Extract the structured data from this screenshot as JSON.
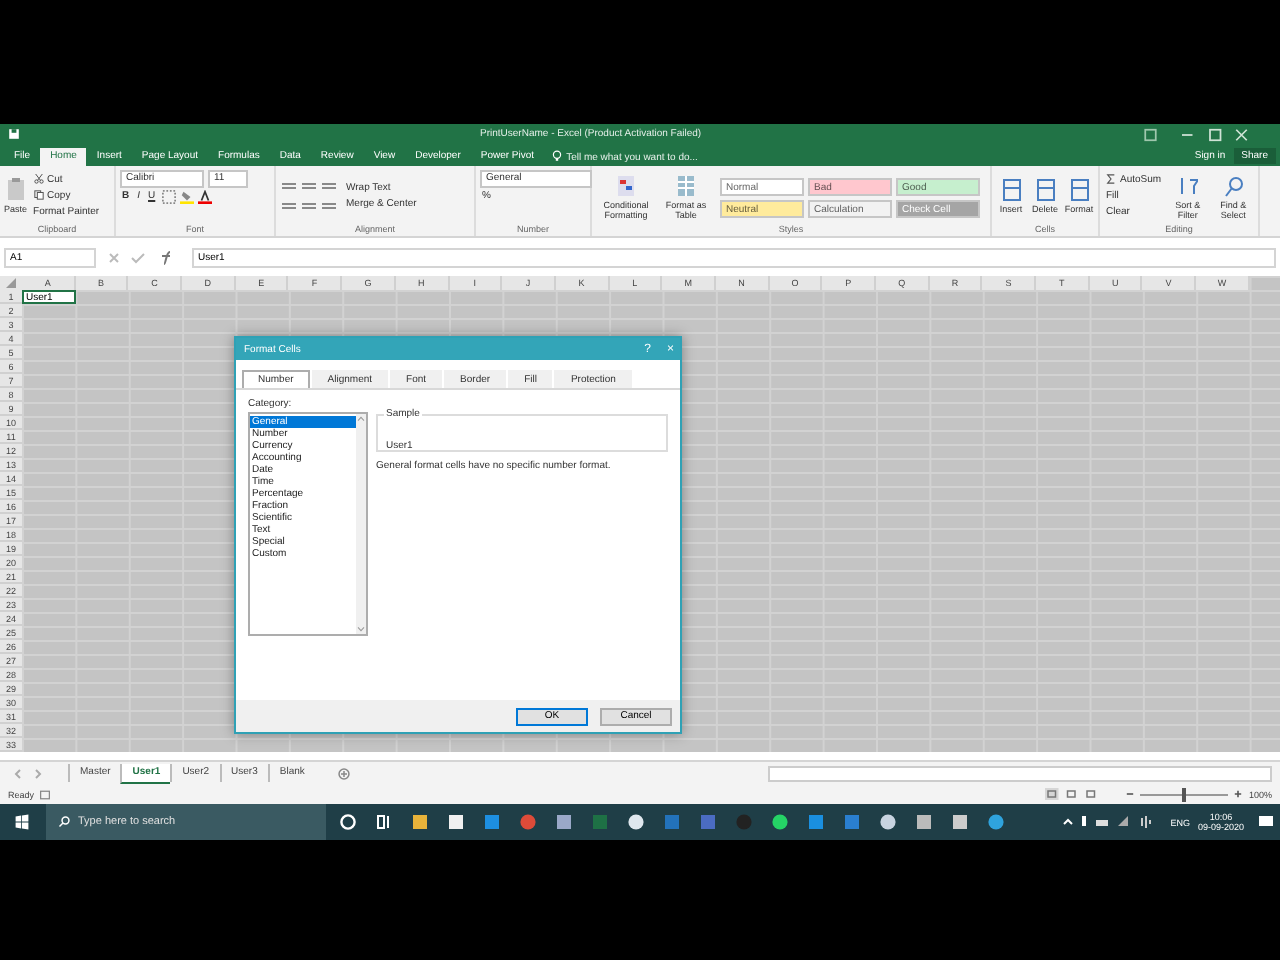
{
  "window": {
    "title": "PrintUserName - Excel (Product Activation Failed)"
  },
  "ribbon_tabs": [
    {
      "label": "File",
      "selected": false
    },
    {
      "label": "Home",
      "selected": true
    },
    {
      "label": "Insert",
      "selected": false
    },
    {
      "label": "Page Layout",
      "selected": false
    },
    {
      "label": "Formulas",
      "selected": false
    },
    {
      "label": "Data",
      "selected": false
    },
    {
      "label": "Review",
      "selected": false
    },
    {
      "label": "View",
      "selected": false
    },
    {
      "label": "Developer",
      "selected": false
    },
    {
      "label": "Power Pivot",
      "selected": false
    }
  ],
  "tell_me": {
    "placeholder": "Tell me what you want to do..."
  },
  "account": {
    "sign_in": "Sign in",
    "share": "Share"
  },
  "ribbon": {
    "clipboard": {
      "label": "Clipboard",
      "paste": "Paste",
      "cut": "Cut",
      "copy": "Copy",
      "format_painter": "Format Painter"
    },
    "font": {
      "label": "Font",
      "name": "Calibri",
      "size": "11",
      "bold": "B",
      "italic": "I",
      "underline": "U"
    },
    "alignment": {
      "label": "Alignment",
      "wrap_text": "Wrap Text",
      "merge": "Merge & Center"
    },
    "number": {
      "label": "Number",
      "format": "General",
      "percent": "%"
    },
    "styles": {
      "label": "Styles",
      "conditional": "Conditional Formatting",
      "table": "Format as Table",
      "cell_styles": [
        {
          "label": "Normal",
          "color": "#ffffff"
        },
        {
          "label": "Bad",
          "color": "#ffc7ce"
        },
        {
          "label": "Good",
          "color": "#c6efce"
        },
        {
          "label": "Neutral",
          "color": "#ffeb9c"
        },
        {
          "label": "Calculation",
          "color": "#f2f2f2"
        },
        {
          "label": "Check Cell",
          "color": "#a5a5a5"
        }
      ]
    },
    "cells": {
      "label": "Cells",
      "buttons": [
        "Insert",
        "Delete",
        "Format"
      ]
    },
    "editing": {
      "label": "Editing",
      "autosum": "AutoSum",
      "fill": "Fill",
      "clear": "Clear",
      "sort": "Sort & Filter",
      "find": "Find & Select"
    }
  },
  "formula_bar": {
    "name_box": "A1",
    "value": "User1"
  },
  "grid": {
    "columns": [
      "A",
      "B",
      "C",
      "D",
      "E",
      "F",
      "G",
      "H",
      "I",
      "J",
      "K",
      "L",
      "M",
      "N",
      "O",
      "P",
      "Q",
      "R",
      "S",
      "T",
      "U",
      "V",
      "W"
    ],
    "rows": [
      "1",
      "2",
      "3",
      "4",
      "5",
      "6",
      "7",
      "8",
      "9",
      "10",
      "11",
      "12",
      "13",
      "14",
      "15",
      "16",
      "17",
      "18",
      "19",
      "20",
      "21",
      "22",
      "23",
      "24",
      "25",
      "26",
      "27",
      "28",
      "29",
      "30",
      "31",
      "32",
      "33"
    ],
    "active_cell": {
      "value": "User1"
    }
  },
  "dialog": {
    "title": "Format Cells",
    "help": "?",
    "close": "×",
    "tabs": [
      {
        "label": "Number",
        "selected": true
      },
      {
        "label": "Alignment",
        "selected": false
      },
      {
        "label": "Font",
        "selected": false
      },
      {
        "label": "Border",
        "selected": false
      },
      {
        "label": "Fill",
        "selected": false
      },
      {
        "label": "Protection",
        "selected": false
      }
    ],
    "category_label": "Category:",
    "categories": [
      {
        "label": "General",
        "selected": true
      },
      {
        "label": "Number",
        "selected": false
      },
      {
        "label": "Currency",
        "selected": false
      },
      {
        "label": "Accounting",
        "selected": false
      },
      {
        "label": "Date",
        "selected": false
      },
      {
        "label": "Time",
        "selected": false
      },
      {
        "label": "Percentage",
        "selected": false
      },
      {
        "label": "Fraction",
        "selected": false
      },
      {
        "label": "Scientific",
        "selected": false
      },
      {
        "label": "Text",
        "selected": false
      },
      {
        "label": "Special",
        "selected": false
      },
      {
        "label": "Custom",
        "selected": false
      }
    ],
    "sample_label": "Sample",
    "sample_value": "User1",
    "description": "General format cells have no specific number format.",
    "buttons": [
      "OK",
      "Cancel"
    ]
  },
  "sheet_tabs": [
    {
      "label": "Master",
      "selected": false
    },
    {
      "label": "User1",
      "selected": true
    },
    {
      "label": "User2",
      "selected": false
    },
    {
      "label": "User3",
      "selected": false
    },
    {
      "label": "Blank",
      "selected": false
    }
  ],
  "status_bar": {
    "status": "Ready",
    "zoom": "100%",
    "zoom_level": {
      "level": 0.5
    }
  },
  "taskbar": {
    "search": {
      "placeholder": "Type here to search"
    },
    "language": "ENG",
    "time": "10:06",
    "date": "09-09-2020"
  }
}
